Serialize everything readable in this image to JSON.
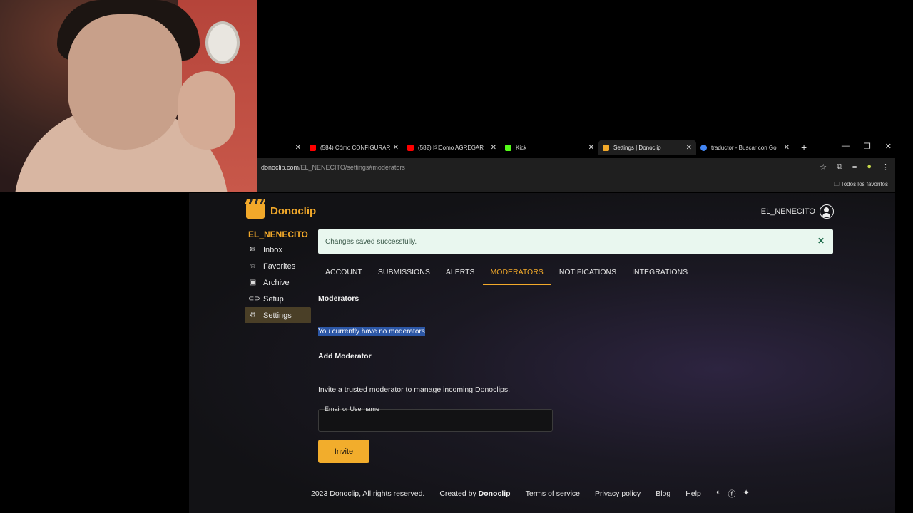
{
  "browser": {
    "tabs": [
      {
        "title": "",
        "favicon_color": "#000000"
      },
      {
        "title": "(584) Cómo CONFIGURAR",
        "favicon_color": "#ff0000"
      },
      {
        "title": "(582) 🅂Como AGREGAR",
        "favicon_color": "#ff0000"
      },
      {
        "title": "Kick",
        "favicon_color": "#53fc18"
      },
      {
        "title": "Settings | Donoclip",
        "favicon_color": "#f2a92a"
      },
      {
        "title": "traductor - Buscar con Go",
        "favicon_color": "#4285f4"
      }
    ],
    "new_tab": "+",
    "url_domain": "donoclip.com",
    "url_path": "/EL_NENECITO/settings#moderators",
    "bookmarks_folder": "Todos los favoritos"
  },
  "site": {
    "brand": "Donoclip",
    "brand_color": "#f2a92a",
    "user": "EL_NENECITO"
  },
  "sidebar": {
    "username": "EL_NENECITO",
    "items": [
      {
        "label": "Inbox",
        "icon": "inbox-icon"
      },
      {
        "label": "Favorites",
        "icon": "star-icon"
      },
      {
        "label": "Archive",
        "icon": "archive-icon"
      },
      {
        "label": "Setup",
        "icon": "link-icon"
      },
      {
        "label": "Settings",
        "icon": "gear-icon",
        "active": true
      }
    ]
  },
  "alert": {
    "message": "Changes saved successfully."
  },
  "tabs": [
    "ACCOUNT",
    "SUBMISSIONS",
    "ALERTS",
    "MODERATORS",
    "NOTIFICATIONS",
    "INTEGRATIONS"
  ],
  "moderators": {
    "heading": "Moderators",
    "empty_text": "You currently have no moderators",
    "add_heading": "Add Moderator",
    "description": "Invite a trusted moderator to manage incoming Donoclips.",
    "field_label": "Email or Username",
    "field_value": "",
    "invite_label": "Invite"
  },
  "footer": {
    "copyright": "2023 Donoclip, All rights reserved.",
    "created_by": "Created by",
    "created_by_name": "Donoclip",
    "terms": "Terms of service",
    "privacy": "Privacy policy",
    "blog": "Blog",
    "help": "Help"
  }
}
